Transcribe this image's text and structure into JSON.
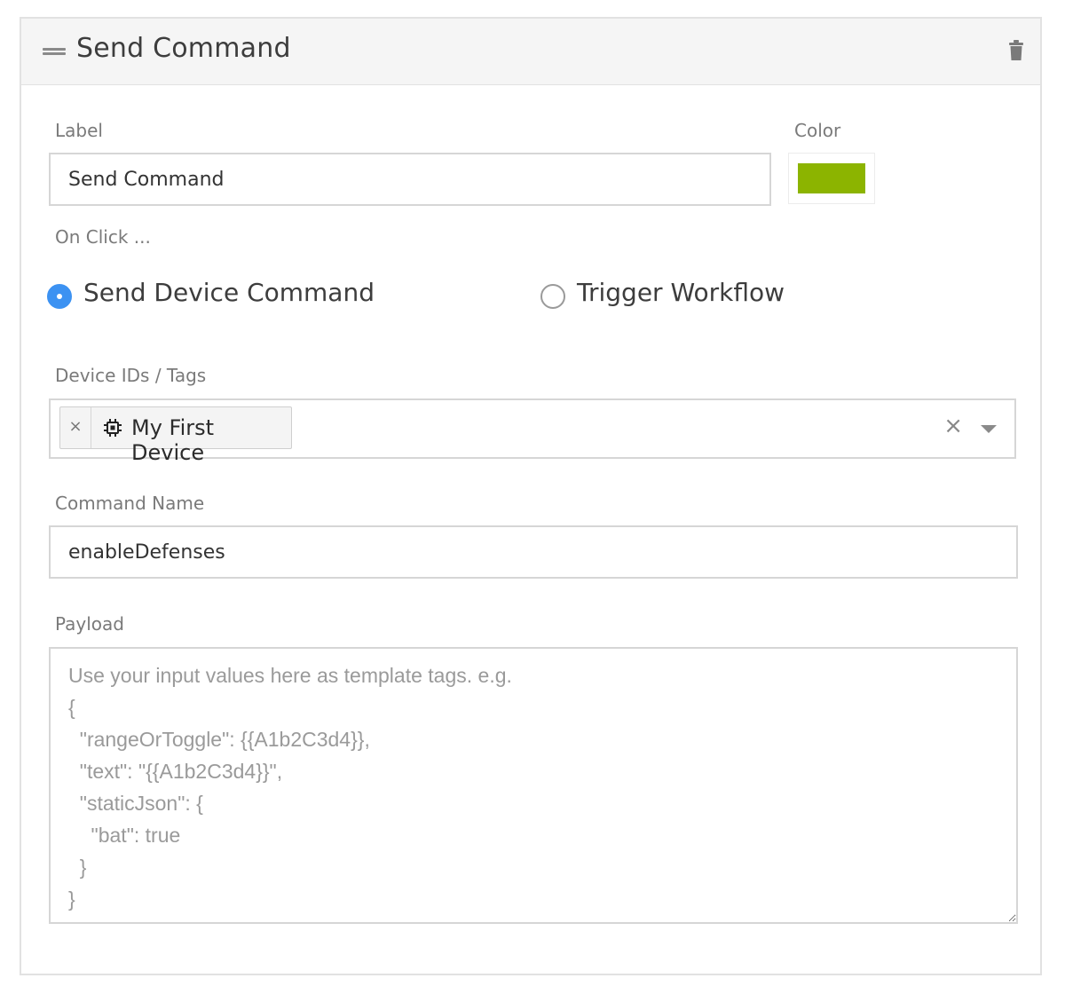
{
  "header": {
    "title": "Send Command"
  },
  "label_field": {
    "label": "Label",
    "value": "Send Command"
  },
  "color_field": {
    "label": "Color",
    "value": "#8cb400"
  },
  "on_click": {
    "label": "On Click ...",
    "options": [
      {
        "label": "Send Device Command",
        "selected": true
      },
      {
        "label": "Trigger Workflow",
        "selected": false
      }
    ]
  },
  "devices": {
    "label": "Device IDs / Tags",
    "tags": [
      {
        "label": "My First Device",
        "remove": "×"
      }
    ],
    "clear": "×"
  },
  "command_name": {
    "label": "Command Name",
    "value": "enableDefenses"
  },
  "payload": {
    "label": "Payload",
    "placeholder": "Use your input values here as template tags. e.g.\n{\n  \"rangeOrToggle\": {{A1b2C3d4}},\n  \"text\": \"{{A1b2C3d4}}\",\n  \"staticJson\": {\n    \"bat\": true\n  }\n}"
  },
  "colors": {
    "accent": "#3c92f2",
    "swatch": "#8cb400"
  },
  "icons": {
    "drag": "drag-handle-icon",
    "trash": "trash-icon",
    "chip": "chip-icon",
    "dropdown": "chevron-down-icon"
  }
}
